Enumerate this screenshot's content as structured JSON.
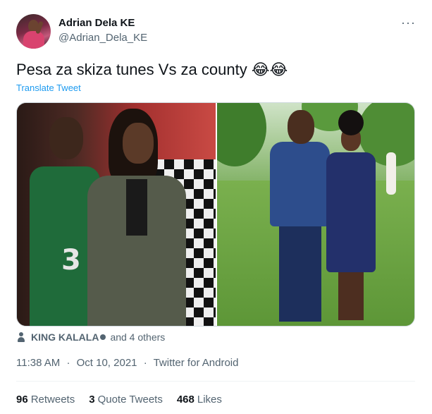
{
  "author": {
    "display_name": "Adrian Dela KE",
    "handle": "@Adrian_Dela_KE"
  },
  "tweet": {
    "text": "Pesa za skiza tunes Vs  za county",
    "emojis": "😂😂",
    "translate_label": "Translate Tweet"
  },
  "liked_by": {
    "name": "KING KALALA",
    "others": "and 4 others"
  },
  "meta": {
    "time": "11:38 AM",
    "date": "Oct 10, 2021",
    "source": "Twitter for Android",
    "separator": "·"
  },
  "stats": {
    "retweets_count": "96",
    "retweets_label": "Retweets",
    "quotes_count": "3",
    "quotes_label": "Quote Tweets",
    "likes_count": "468",
    "likes_label": "Likes"
  },
  "menu": {
    "more_icon": "more-horizontal-icon"
  },
  "colors": {
    "accent": "#1d9bf0",
    "secondary_text": "#536471",
    "primary_text": "#0f1419"
  }
}
